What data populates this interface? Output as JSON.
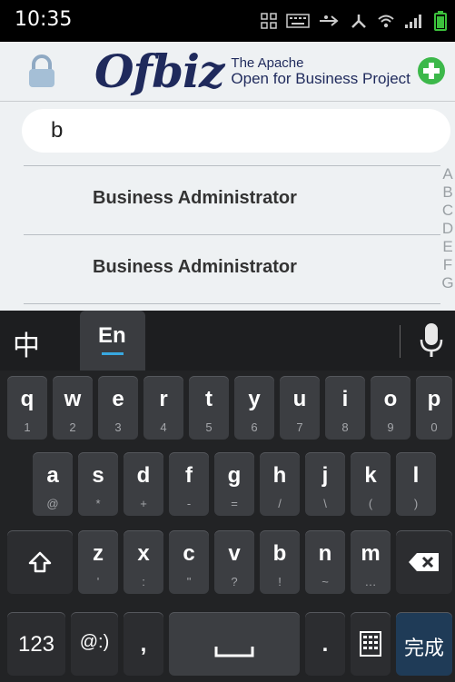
{
  "status_bar": {
    "time": "10:35",
    "icons": [
      "grid-icon",
      "keyboard-icon",
      "usb-icon",
      "connection-icon",
      "wifi-icon",
      "signal-icon",
      "battery-icon"
    ]
  },
  "header": {
    "logo_word": "Ofbiz",
    "logo_tagline_1": "The Apache",
    "logo_tagline_2": "Open for Business Project",
    "left_icon": "lock-icon",
    "right_icon": "add-icon"
  },
  "search": {
    "value": "b"
  },
  "list": {
    "items": [
      "Business Administrator",
      "Business Administrator"
    ]
  },
  "index_bar": [
    "A",
    "B",
    "C",
    "D",
    "E",
    "F",
    "G"
  ],
  "ime": {
    "tab_zh": "中",
    "tab_en": "En",
    "mic_icon": "microphone-icon"
  },
  "keyboard": {
    "row1": [
      {
        "main": "q",
        "sub": "1"
      },
      {
        "main": "w",
        "sub": "2"
      },
      {
        "main": "e",
        "sub": "3"
      },
      {
        "main": "r",
        "sub": "4"
      },
      {
        "main": "t",
        "sub": "5"
      },
      {
        "main": "y",
        "sub": "6"
      },
      {
        "main": "u",
        "sub": "7"
      },
      {
        "main": "i",
        "sub": "8"
      },
      {
        "main": "o",
        "sub": "9"
      },
      {
        "main": "p",
        "sub": "0"
      }
    ],
    "row2": [
      {
        "main": "a",
        "sub": "@"
      },
      {
        "main": "s",
        "sub": "*"
      },
      {
        "main": "d",
        "sub": "+"
      },
      {
        "main": "f",
        "sub": "-"
      },
      {
        "main": "g",
        "sub": "="
      },
      {
        "main": "h",
        "sub": "/"
      },
      {
        "main": "j",
        "sub": "\\"
      },
      {
        "main": "k",
        "sub": "("
      },
      {
        "main": "l",
        "sub": ")"
      }
    ],
    "row3": [
      {
        "main": "z",
        "sub": "'"
      },
      {
        "main": "x",
        "sub": ":"
      },
      {
        "main": "c",
        "sub": "\""
      },
      {
        "main": "v",
        "sub": "?"
      },
      {
        "main": "b",
        "sub": "!"
      },
      {
        "main": "n",
        "sub": "~"
      },
      {
        "main": "m",
        "sub": "…"
      }
    ],
    "shift_icon": "shift-icon",
    "backspace_icon": "backspace-icon",
    "key_123": "123",
    "key_at": "@:)",
    "key_comma": ",",
    "key_period": ".",
    "layout_icon": "keyboard-layout-icon",
    "done_label": "完成"
  }
}
